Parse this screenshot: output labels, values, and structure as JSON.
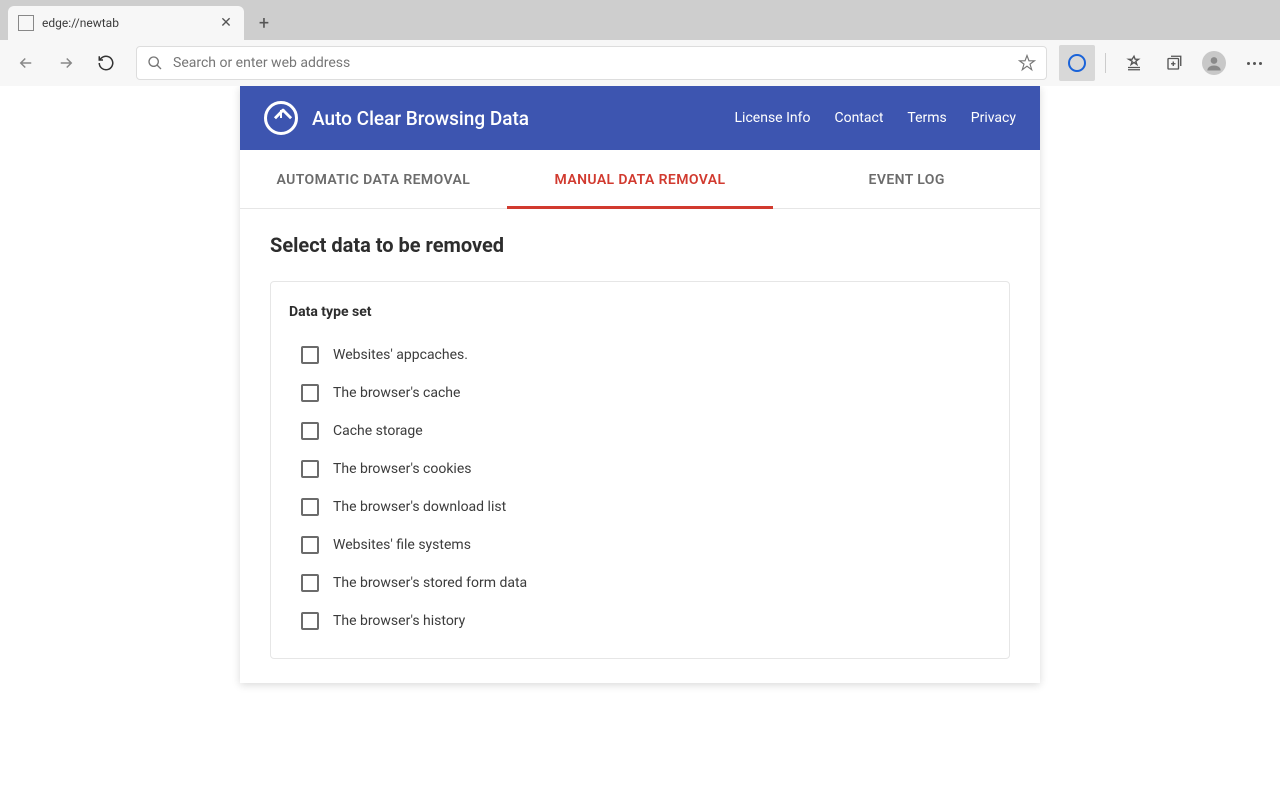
{
  "browser": {
    "tab_title": "edge://newtab",
    "address_placeholder": "Search or enter web address"
  },
  "app": {
    "title": "Auto Clear Browsing Data",
    "nav": {
      "license": "License Info",
      "contact": "Contact",
      "terms": "Terms",
      "privacy": "Privacy"
    }
  },
  "tabs": {
    "auto": "AUTOMATIC DATA REMOVAL",
    "manual": "MANUAL DATA REMOVAL",
    "log": "EVENT LOG"
  },
  "content": {
    "heading": "Select data to be removed",
    "set_title": "Data type set",
    "items": [
      "Websites' appcaches.",
      "The browser's cache",
      "Cache storage",
      "The browser's cookies",
      "The browser's download list",
      "Websites' file systems",
      "The browser's stored form data",
      "The browser's history"
    ]
  }
}
